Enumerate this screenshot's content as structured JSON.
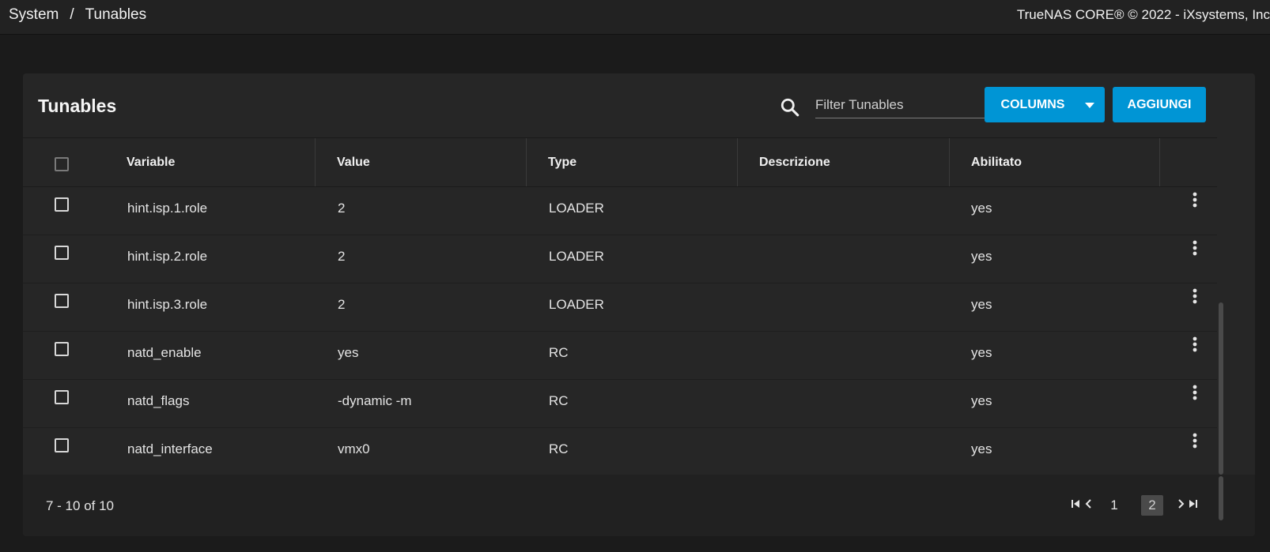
{
  "topbar": {
    "breadcrumb": [
      "System",
      "Tunables"
    ],
    "separator": "/",
    "copyright": "TrueNAS CORE® © 2022 - iXsystems, Inc"
  },
  "card": {
    "title": "Tunables",
    "filter_placeholder": "Filter Tunables",
    "columns_button": "COLUMNS",
    "add_button": "AGGIUNGI"
  },
  "table": {
    "headers": {
      "variable": "Variable",
      "value": "Value",
      "type": "Type",
      "description": "Descrizione",
      "enabled": "Abilitato"
    },
    "rows": [
      {
        "variable": "hint.isp.1.role",
        "value": "2",
        "type": "LOADER",
        "description": "",
        "enabled": "yes"
      },
      {
        "variable": "hint.isp.2.role",
        "value": "2",
        "type": "LOADER",
        "description": "",
        "enabled": "yes"
      },
      {
        "variable": "hint.isp.3.role",
        "value": "2",
        "type": "LOADER",
        "description": "",
        "enabled": "yes"
      },
      {
        "variable": "natd_enable",
        "value": "yes",
        "type": "RC",
        "description": "",
        "enabled": "yes"
      },
      {
        "variable": "natd_flags",
        "value": "-dynamic -m",
        "type": "RC",
        "description": "",
        "enabled": "yes"
      },
      {
        "variable": "natd_interface",
        "value": "vmx0",
        "type": "RC",
        "description": "",
        "enabled": "yes"
      }
    ]
  },
  "pagination": {
    "range": "7 - 10 of 10",
    "pages": [
      "1",
      "2"
    ],
    "active_page": "2"
  },
  "colors": {
    "accent": "#0095d5",
    "background": "#1b1b1b",
    "card": "#262626"
  }
}
